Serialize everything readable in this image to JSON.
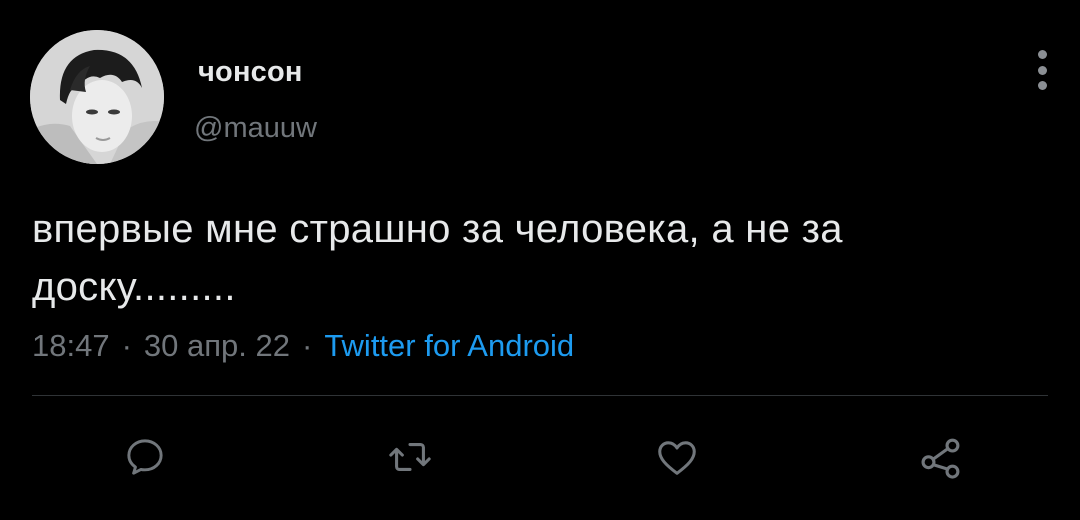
{
  "tweet": {
    "display_name": "чонсон",
    "handle": "@mauuw",
    "text": "впервые мне страшно за человека, а не за доску.........",
    "time": "18:47",
    "date": "30 апр. 22",
    "separator": "·",
    "source": "Twitter for Android"
  },
  "actions": {
    "reply_icon": "reply-icon",
    "retweet_icon": "retweet-icon",
    "like_icon": "heart-icon",
    "share_icon": "share-icon"
  },
  "colors": {
    "background": "#000000",
    "text": "#e7e9ea",
    "secondary": "#71767b",
    "link": "#1d9bf0",
    "divider": "#2f3336"
  }
}
